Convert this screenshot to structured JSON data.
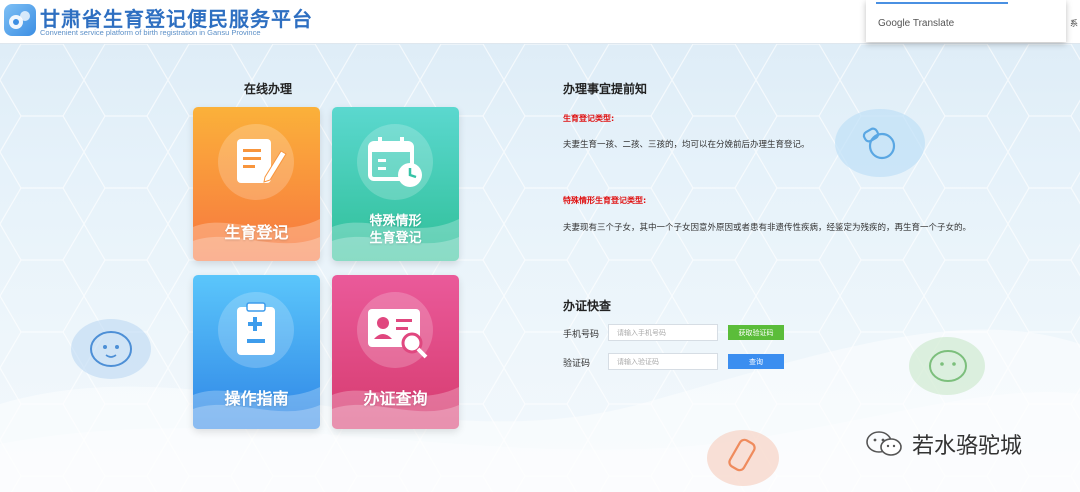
{
  "header": {
    "title": "甘肃省生育登记便民服务平台",
    "subtitle": "Convenient service platform of birth registration in Gansu Province",
    "translate_brand": "Google",
    "translate_word": "Translate",
    "edge_text": "系"
  },
  "online": {
    "title": "在线办理",
    "cards": [
      {
        "label": "生育登记",
        "icon": "edit-document-icon",
        "color": "#f9823a"
      },
      {
        "label_line1": "特殊情形",
        "label_line2": "生育登记",
        "icon": "calendar-clock-icon",
        "color": "#37c9b3"
      },
      {
        "label": "操作指南",
        "icon": "clipboard-guide-icon",
        "color": "#3ea2f0"
      },
      {
        "label": "办证查询",
        "icon": "id-card-search-icon",
        "color": "#e0477f"
      }
    ]
  },
  "notice": {
    "title": "办理事宜提前知",
    "type1_label": "生育登记类型:",
    "type1_text": "夫妻生育一孩、二孩、三孩的，均可以在分娩前后办理生育登记。",
    "type2_label": "特殊情形生育登记类型:",
    "type2_text": "夫妻现有三个子女，其中一个子女因意外原因或者患有非遗传性疾病，经鉴定为残疾的，再生育一个子女的。"
  },
  "quick": {
    "title": "办证快查",
    "phone_label": "手机号码",
    "phone_placeholder": "请输入手机号码",
    "get_code_button": "获取验证码",
    "code_label": "验证码",
    "code_placeholder": "请输入验证码",
    "query_button": "查询"
  },
  "watermark": {
    "text": "若水骆驼城"
  },
  "colors": {
    "brand_blue": "#2e6fc1",
    "get_code_green": "#5bbd3a",
    "query_blue": "#3b8ef0",
    "notice_red": "#e01010"
  }
}
